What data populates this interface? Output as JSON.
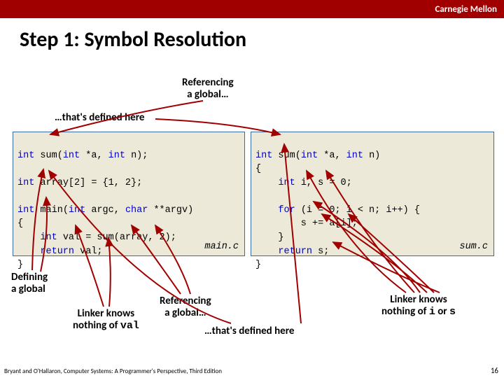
{
  "header": {
    "brand": "Carnegie Mellon"
  },
  "slide": {
    "title": "Step 1: Symbol Resolution",
    "labels": {
      "ref_global_top": "Referencing\na global…",
      "defined_here_top": "…that's defined here",
      "defining_global": "Defining\na global",
      "linker_val_l1": "Linker knows",
      "linker_val_l2": "nothing of ",
      "linker_val_code": "val",
      "ref_global_mid": "Referencing\na global…",
      "defined_here_mid": "…that's defined here",
      "linker_is_l1": "Linker knows",
      "linker_is_l2_a": "nothing of ",
      "linker_is_code1": "i",
      "linker_is_l2_b": " or ",
      "linker_is_code2": "s"
    },
    "code_left": {
      "l1a": "int",
      "l1b": " sum(",
      "l1c": "int",
      "l1d": " *a, ",
      "l1e": "int",
      "l1f": " n);",
      "l3a": "int",
      "l3b": " array[2] = {1, 2};",
      "l5a": "int",
      "l5b": " main(",
      "l5c": "int",
      "l5d": " argc, ",
      "l5e": "char",
      "l5f": " **argv)",
      "l6": "{",
      "l7a": "    ",
      "l7b": "int",
      "l7c": " val = sum(array, 2);",
      "l8a": "    ",
      "l8b": "return",
      "l8c": " val;",
      "l9": "}",
      "filename": "main.c"
    },
    "code_right": {
      "l1a": "int",
      "l1b": " sum(",
      "l1c": "int",
      "l1d": " *a, ",
      "l1e": "int",
      "l1f": " n)",
      "l2": "{",
      "l3a": "    ",
      "l3b": "int",
      "l3c": " i, s = 0;",
      "l5a": "    ",
      "l5b": "for",
      "l5c": " (i = 0; i < n; i++) {",
      "l6": "        s += a[i];",
      "l7": "    }",
      "l8a": "    ",
      "l8b": "return",
      "l8c": " s;",
      "l9": "}",
      "filename": "sum.c"
    }
  },
  "footer": {
    "credit": "Bryant and O'Hallaron, Computer Systems: A Programmer's Perspective, Third Edition",
    "page": "16"
  }
}
